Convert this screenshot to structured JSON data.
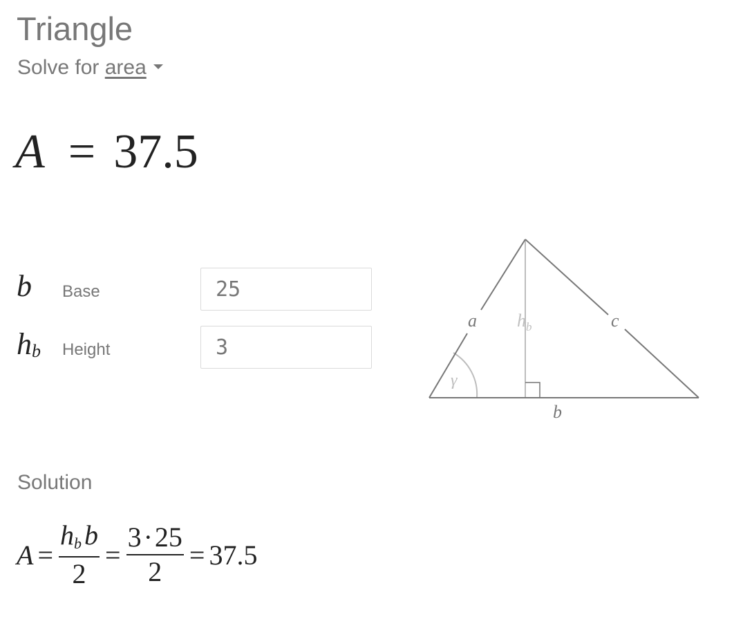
{
  "header": {
    "title": "Triangle",
    "solve_prefix": "Solve for",
    "solve_target": "area"
  },
  "result": {
    "variable": "A",
    "equals": "=",
    "value": "37.5"
  },
  "inputs": [
    {
      "symbol": "b",
      "subscript": "",
      "label": "Base",
      "value": "25"
    },
    {
      "symbol": "h",
      "subscript": "b",
      "label": "Height",
      "value": "3"
    }
  ],
  "diagram": {
    "labels": {
      "side_a": "a",
      "side_b": "b",
      "side_c": "c",
      "height_h": "h",
      "height_sub": "b",
      "angle": "γ"
    },
    "colors": {
      "stroke": "#777777",
      "height_stroke": "#bdbdbd",
      "height_label": "#c0c0c0"
    }
  },
  "solution": {
    "heading": "Solution",
    "lhs": "A",
    "eq": "=",
    "frac1_num_h": "h",
    "frac1_num_sub": "b",
    "frac1_num_b": "b",
    "frac1_den": "2",
    "frac2_num_a": "3",
    "frac2_num_dot": "·",
    "frac2_num_b": "25",
    "frac2_den": "2",
    "final": "37.5"
  },
  "colors": {
    "text_gray": "#777777",
    "text_dark": "#222222",
    "input_border": "#dadada"
  }
}
